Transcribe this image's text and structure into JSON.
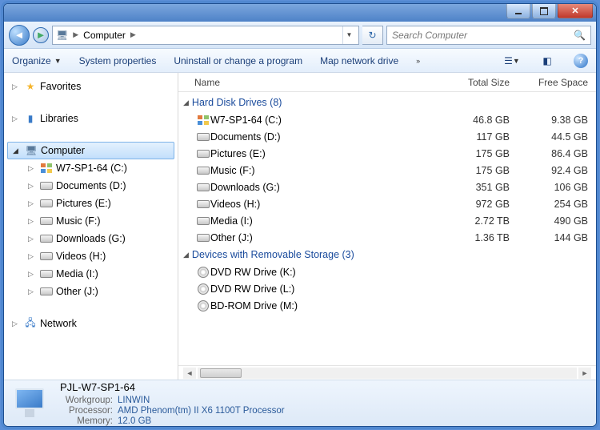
{
  "address": {
    "root_icon": "computer",
    "crumb": "Computer"
  },
  "search": {
    "placeholder": "Search Computer"
  },
  "toolbar": {
    "organize": "Organize",
    "sysprops": "System properties",
    "uninstall": "Uninstall or change a program",
    "mapdrive": "Map network drive"
  },
  "sidebar": {
    "favorites": "Favorites",
    "libraries": "Libraries",
    "computer": "Computer",
    "network": "Network",
    "drives": [
      "W7-SP1-64 (C:)",
      "Documents (D:)",
      "Pictures (E:)",
      "Music (F:)",
      "Downloads (G:)",
      "Videos (H:)",
      "Media (I:)",
      "Other (J:)"
    ]
  },
  "columns": {
    "name": "Name",
    "total": "Total Size",
    "free": "Free Space"
  },
  "groups": {
    "hdd": "Hard Disk Drives (8)",
    "removable": "Devices with Removable Storage (3)"
  },
  "hdd": [
    {
      "name": "W7-SP1-64 (C:)",
      "total": "46.8 GB",
      "free": "9.38 GB",
      "system": true
    },
    {
      "name": "Documents (D:)",
      "total": "117 GB",
      "free": "44.5 GB"
    },
    {
      "name": "Pictures (E:)",
      "total": "175 GB",
      "free": "86.4 GB"
    },
    {
      "name": "Music (F:)",
      "total": "175 GB",
      "free": "92.4 GB"
    },
    {
      "name": "Downloads (G:)",
      "total": "351 GB",
      "free": "106 GB"
    },
    {
      "name": "Videos (H:)",
      "total": "972 GB",
      "free": "254 GB"
    },
    {
      "name": "Media (I:)",
      "total": "2.72 TB",
      "free": "490 GB"
    },
    {
      "name": "Other (J:)",
      "total": "1.36 TB",
      "free": "144 GB"
    }
  ],
  "removable": [
    {
      "name": "DVD RW Drive (K:)"
    },
    {
      "name": "DVD RW Drive (L:)"
    },
    {
      "name": "BD-ROM Drive (M:)"
    }
  ],
  "details": {
    "computer_name": "PJL-W7-SP1-64",
    "workgroup_label": "Workgroup:",
    "workgroup": "LINWIN",
    "processor_label": "Processor:",
    "processor": "AMD Phenom(tm) II X6 1100T Processor",
    "memory_label": "Memory:",
    "memory": "12.0 GB"
  }
}
